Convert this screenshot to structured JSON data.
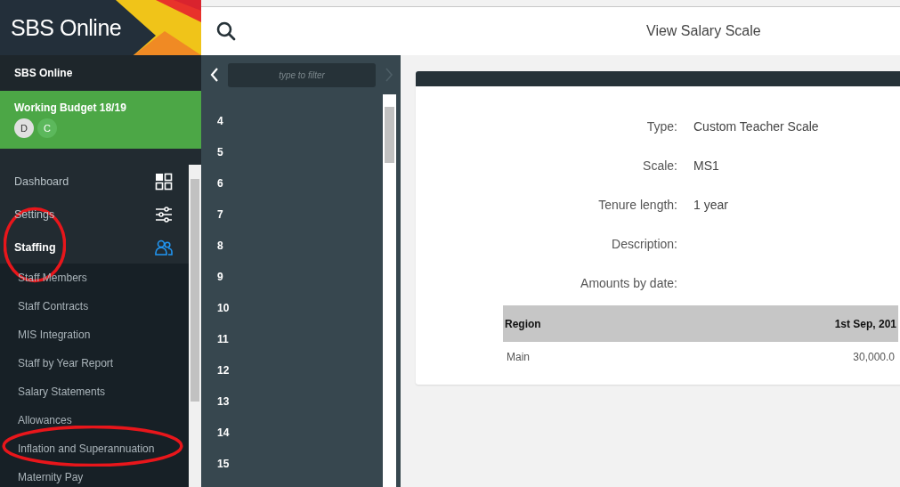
{
  "sidebar": {
    "logo": "SBS Online",
    "org": "SBS Online",
    "budget": {
      "title": "Working Budget 18/19",
      "avatars": [
        {
          "letter": "D",
          "color": "#e0e0e0"
        },
        {
          "letter": "C",
          "color": "#5cb85c"
        }
      ]
    },
    "nav": [
      {
        "label": "Dashboard",
        "selected": false
      },
      {
        "label": "Settings",
        "selected": false
      },
      {
        "label": "Staffing",
        "selected": true
      }
    ],
    "sub_items": [
      "Staff Members",
      "Staff Contracts",
      "MIS Integration",
      "Staff by Year Report",
      "Salary Statements",
      "Allowances",
      "Inflation and Superannuation",
      "Maternity Pay"
    ]
  },
  "topbar": {
    "title": "View Salary Scale"
  },
  "list_panel": {
    "filter": {
      "placeholder": "type to filter"
    },
    "items": [
      "4",
      "5",
      "6",
      "7",
      "8",
      "9",
      "10",
      "11",
      "12",
      "13",
      "14",
      "15"
    ]
  },
  "detail": {
    "fields": [
      {
        "label": "Type:",
        "value": "Custom Teacher Scale"
      },
      {
        "label": "Scale:",
        "value": "MS1"
      },
      {
        "label": "Tenure length:",
        "value": "1 year"
      },
      {
        "label": "Description:"
      },
      {
        "label": "Amounts by date:"
      }
    ],
    "table": {
      "columns": [
        "Region",
        "1st Sep, 201"
      ],
      "rows": [
        [
          "Main",
          "30,000.0"
        ]
      ]
    }
  },
  "annotations": [
    {
      "kind": "oval"
    },
    {
      "kind": "oval"
    }
  ]
}
